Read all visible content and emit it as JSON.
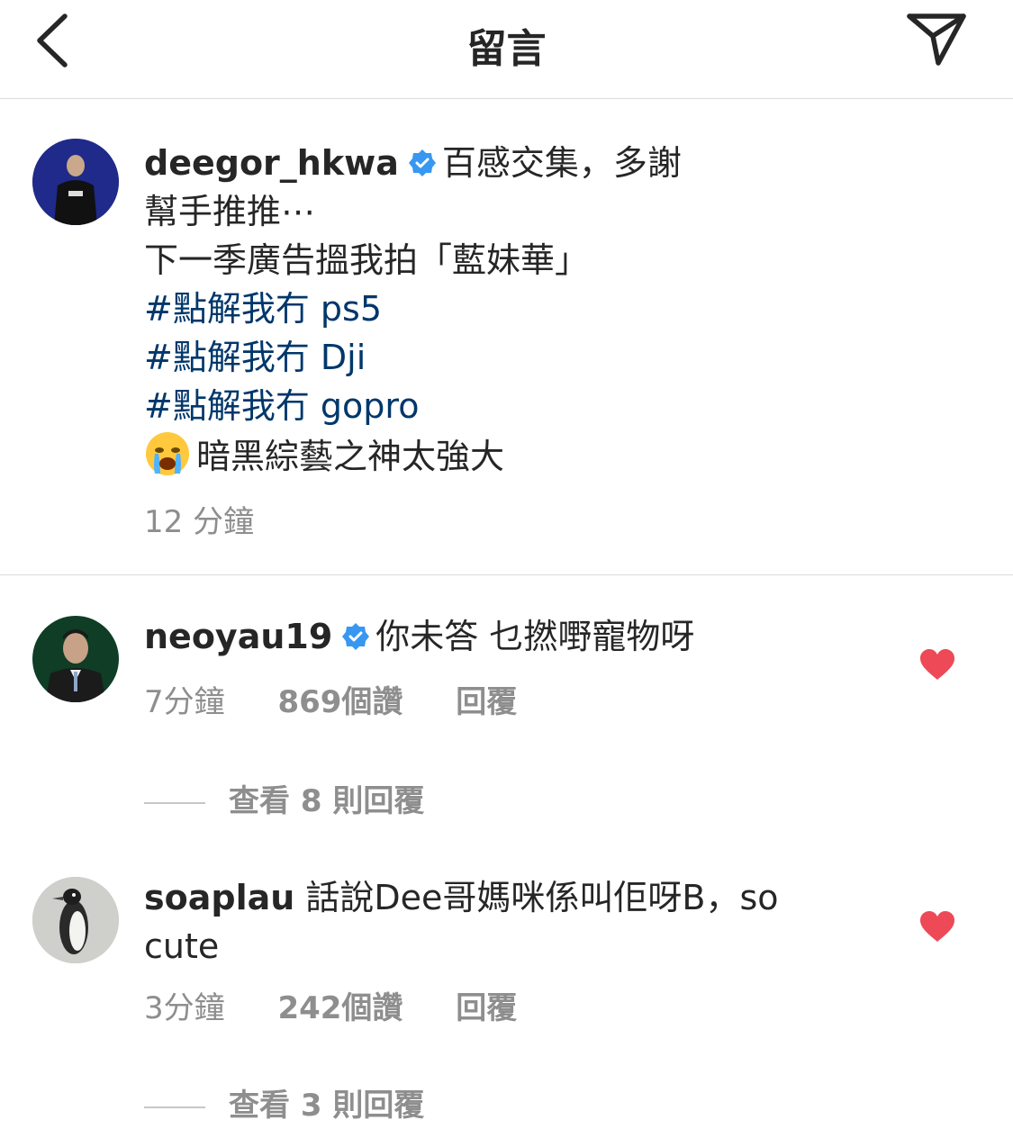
{
  "header": {
    "title": "留言",
    "back_icon": "chevron-left-icon",
    "share_icon": "paper-plane-icon"
  },
  "caption": {
    "username": "deegor_hkwa",
    "text_first": "百感交集，多謝",
    "lines": [
      "幫手推推⋯",
      "下一季廣告搵我拍「藍妹華」"
    ],
    "hashtags": [
      "#點解我冇 ps5",
      "#點解我冇 Dji",
      "#點解我冇 gopro"
    ],
    "last_line": "暗黑綜藝之神太強大",
    "emoji": "loudly-crying-face",
    "time": "12 分鐘"
  },
  "comments": [
    {
      "username": "neoyau19",
      "verified": true,
      "text_line1": "你未答 乜撚嘢寵物呀",
      "text_line2": "",
      "time": "7分鐘",
      "likes": "869個讚",
      "reply": "回覆",
      "liked": true,
      "view_replies": "查看 8 則回覆"
    },
    {
      "username": "soaplau",
      "verified": false,
      "text_line1": "話說Dee哥媽咪係叫佢呀B，so",
      "text_line2": "cute",
      "time": "3分鐘",
      "likes": "242個讚",
      "reply": "回覆",
      "liked": true,
      "view_replies": "查看 3 則回覆"
    }
  ],
  "colors": {
    "hashtag": "#00376b",
    "verified": "#3897f0",
    "heart": "#ed4956",
    "meta": "#8e8e8e"
  }
}
